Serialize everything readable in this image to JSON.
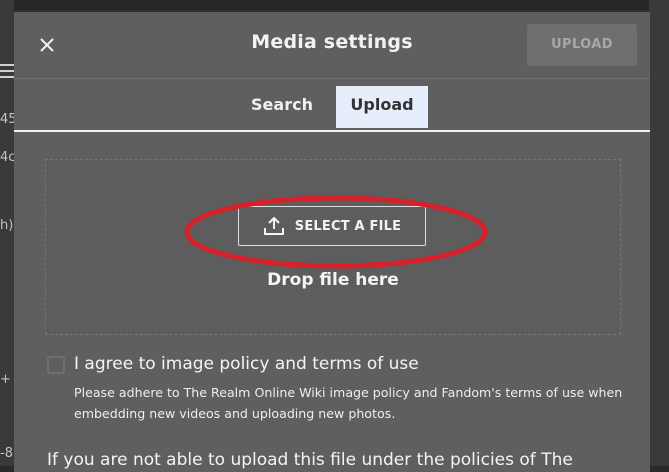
{
  "background": {
    "fragments": [
      "45",
      "4c",
      "h)",
      "+",
      "-8"
    ]
  },
  "modal": {
    "title": "Media settings",
    "upload_label": "UPLOAD",
    "close_icon": "close-icon"
  },
  "tabs": [
    {
      "label": "Search",
      "active": false
    },
    {
      "label": "Upload",
      "active": true
    }
  ],
  "dropzone": {
    "select_label": "SELECT A FILE",
    "select_icon": "upload-icon",
    "drop_text": "Drop file here"
  },
  "agreement": {
    "label": "I agree to image policy and terms of use",
    "description": "Please adhere to The Realm Online Wiki image policy and Fandom's terms of use when embedding new videos and uploading new photos.",
    "checked": false
  },
  "footer_text": "If you are not able to upload this file under the policies of The",
  "colors": {
    "annotation": "#d8202a",
    "active_tab": "#e6eefc",
    "modal_bg": "#5f5f5f"
  }
}
